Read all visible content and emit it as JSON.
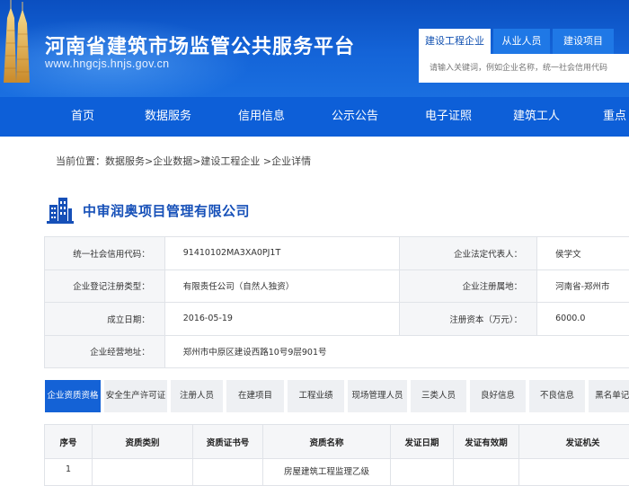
{
  "header": {
    "title": "河南省建筑市场监管公共服务平台",
    "url": "www.hngcjs.hnjs.gov.cn"
  },
  "search": {
    "tabs": [
      "建设工程企业",
      "从业人员",
      "建设项目"
    ],
    "active_tab": 0,
    "placeholder": "请输入关键词，例如企业名称，统一社会信用代码"
  },
  "nav": {
    "items": [
      "首页",
      "数据服务",
      "信用信息",
      "公示公告",
      "电子证照",
      "建筑工人",
      "重点"
    ]
  },
  "breadcrumb": "当前位置：数据服务>企业数据>建设工程企业 >企业详情",
  "company": {
    "name": "中审润奥项目管理有限公司",
    "fields": {
      "credit_code_label": "统一社会信用代码：",
      "credit_code": "91410102MA3XA0PJ1T",
      "legal_rep_label": "企业法定代表人：",
      "legal_rep": "侯学文",
      "reg_type_label": "企业登记注册类型：",
      "reg_type": "有限责任公司（自然人独资）",
      "reg_place_label": "企业注册属地：",
      "reg_place": "河南省-郑州市",
      "date_label": "成立日期：",
      "date": "2016-05-19",
      "capital_label": "注册资本（万元）：",
      "capital": "6000.0",
      "address_label": "企业经营地址：",
      "address": "郑州市中原区建设西路10号9层901号"
    }
  },
  "tabs": {
    "items": [
      "企业资质资格",
      "安全生产许可证",
      "注册人员",
      "在建项目",
      "工程业绩",
      "现场管理人员",
      "三类人员",
      "良好信息",
      "不良信息",
      "黑名单记录"
    ],
    "active": 0
  },
  "table": {
    "headers": [
      "序号",
      "资质类别",
      "资质证书号",
      "资质名称",
      "发证日期",
      "发证有效期",
      "发证机关"
    ],
    "rows": [
      [
        "1",
        "",
        "",
        "房屋建筑工程监理乙级",
        "",
        "",
        ""
      ]
    ]
  },
  "colors": {
    "header_blue": "#0b4fc0",
    "nav_blue": "#0d5fd8",
    "accent": "#1462d6",
    "company_name": "#1650b8"
  }
}
